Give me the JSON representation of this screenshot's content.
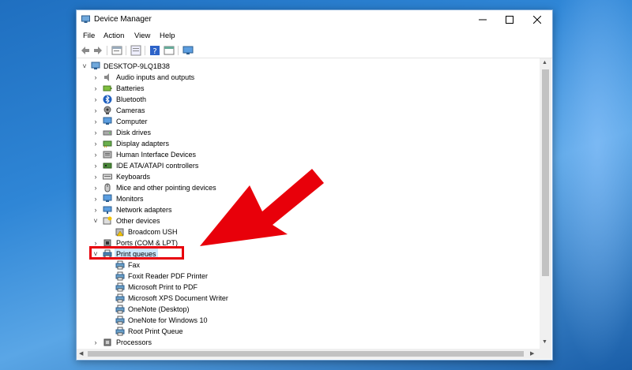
{
  "window": {
    "title": "Device Manager",
    "controls": {
      "minimize": "—",
      "maximize": "☐",
      "close": "✕"
    }
  },
  "menu": [
    "File",
    "Action",
    "View",
    "Help"
  ],
  "toolbar": [
    "back-icon",
    "forward-icon",
    "properties-icon",
    "update-driver-icon",
    "help-icon",
    "show-hidden-icon",
    "monitor-icon"
  ],
  "tree": {
    "root": "DESKTOP-9LQ1B38",
    "categories": [
      {
        "label": "Audio inputs and outputs",
        "icon": "speaker-icon"
      },
      {
        "label": "Batteries",
        "icon": "battery-icon"
      },
      {
        "label": "Bluetooth",
        "icon": "bluetooth-icon"
      },
      {
        "label": "Cameras",
        "icon": "camera-icon"
      },
      {
        "label": "Computer",
        "icon": "computer-icon"
      },
      {
        "label": "Disk drives",
        "icon": "disk-icon"
      },
      {
        "label": "Display adapters",
        "icon": "display-adapter-icon"
      },
      {
        "label": "Human Interface Devices",
        "icon": "hid-icon"
      },
      {
        "label": "IDE ATA/ATAPI controllers",
        "icon": "ide-icon"
      },
      {
        "label": "Keyboards",
        "icon": "keyboard-icon"
      },
      {
        "label": "Mice and other pointing devices",
        "icon": "mouse-icon"
      },
      {
        "label": "Monitors",
        "icon": "monitor-icon"
      },
      {
        "label": "Network adapters",
        "icon": "network-icon"
      }
    ],
    "other_devices": {
      "label": "Other devices",
      "children": [
        "Broadcom USH"
      ]
    },
    "ports": "Ports (COM & LPT)",
    "print_queues": {
      "label": "Print queues",
      "children": [
        "Fax",
        "Foxit Reader PDF Printer",
        "Microsoft Print to PDF",
        "Microsoft XPS Document Writer",
        "OneNote (Desktop)",
        "OneNote for Windows 10",
        "Root Print Queue"
      ]
    },
    "processors": "Processors"
  },
  "colors": {
    "highlight": "#e8000a",
    "arrow": "#e8000a",
    "selection": "#cce8ff"
  }
}
